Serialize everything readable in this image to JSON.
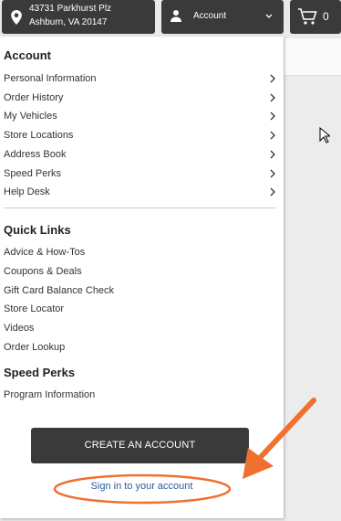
{
  "header": {
    "store": {
      "line1": "43731 Parkhurst Plz",
      "line2": "Ashburn, VA 20147",
      "icon": "location-pin-icon"
    },
    "account": {
      "label": "Account",
      "icon": "user-icon",
      "chevron": "chevron-down-icon"
    },
    "cart": {
      "count": "0",
      "icon": "cart-icon"
    }
  },
  "account_menu": {
    "title": "Account",
    "items": [
      {
        "label": "Personal Information"
      },
      {
        "label": "Order History"
      },
      {
        "label": "My Vehicles"
      },
      {
        "label": "Store Locations"
      },
      {
        "label": "Address Book"
      },
      {
        "label": "Speed Perks"
      },
      {
        "label": "Help Desk"
      }
    ]
  },
  "quick_links": {
    "title": "Quick Links",
    "items": [
      {
        "label": "Advice & How-Tos"
      },
      {
        "label": "Coupons & Deals"
      },
      {
        "label": "Gift Card Balance Check"
      },
      {
        "label": "Store Locator"
      },
      {
        "label": "Videos"
      },
      {
        "label": "Order Lookup"
      }
    ]
  },
  "speed_perks": {
    "title": "Speed Perks",
    "items": [
      {
        "label": "Program Information"
      }
    ]
  },
  "actions": {
    "create_account": "CREATE AN ACCOUNT",
    "sign_in": "Sign in to your account"
  },
  "colors": {
    "dark_bar": "#3a3a3a",
    "link_blue": "#2a5a9a",
    "annotation_orange": "#f07030"
  }
}
